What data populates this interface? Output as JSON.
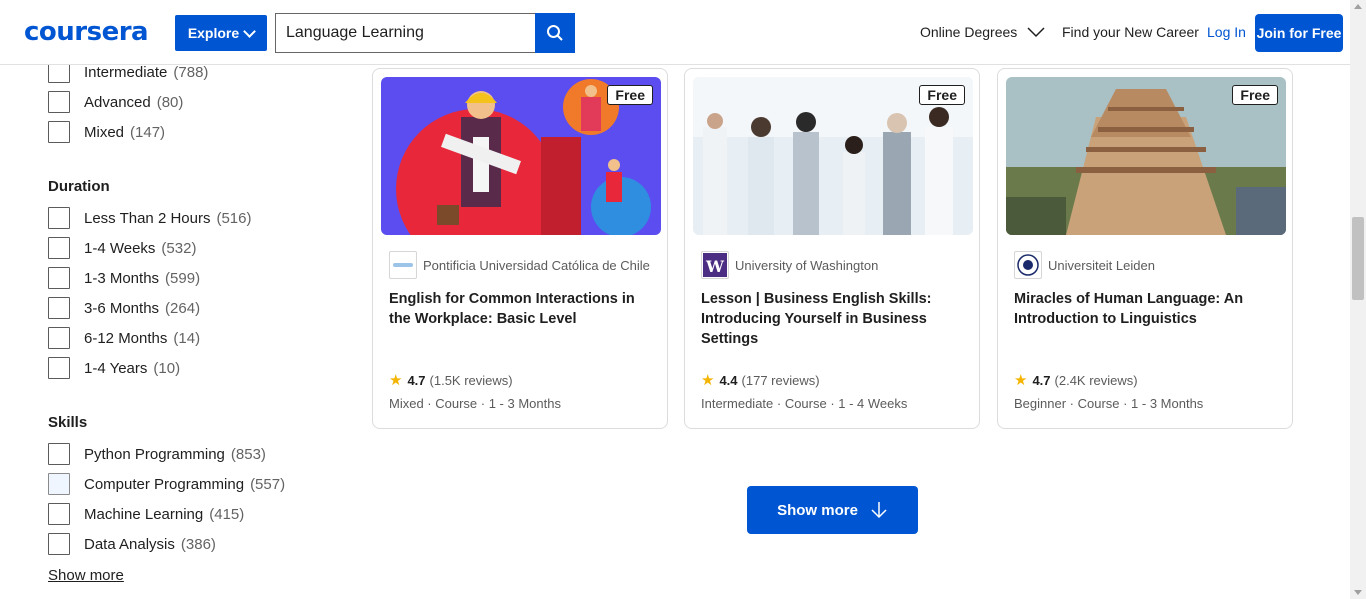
{
  "header": {
    "logo": "coursera",
    "explore_label": "Explore",
    "search_value": "Language Learning",
    "nav_degrees": "Online Degrees",
    "nav_career": "Find your New Career",
    "login": "Log In",
    "join": "Join for Free"
  },
  "filters": {
    "level_items": [
      {
        "label": "Intermediate",
        "count": "(788)"
      },
      {
        "label": "Advanced",
        "count": "(80)"
      },
      {
        "label": "Mixed",
        "count": "(147)"
      }
    ],
    "duration_heading": "Duration",
    "duration_items": [
      {
        "label": "Less Than 2 Hours",
        "count": "(516)"
      },
      {
        "label": "1-4 Weeks",
        "count": "(532)"
      },
      {
        "label": "1-3 Months",
        "count": "(599)"
      },
      {
        "label": "3-6 Months",
        "count": "(264)"
      },
      {
        "label": "6-12 Months",
        "count": "(14)"
      },
      {
        "label": "1-4 Years",
        "count": "(10)"
      }
    ],
    "skills_heading": "Skills",
    "skills_items": [
      {
        "label": "Python Programming",
        "count": "(853)"
      },
      {
        "label": "Computer Programming",
        "count": "(557)"
      },
      {
        "label": "Machine Learning",
        "count": "(415)"
      },
      {
        "label": "Data Analysis",
        "count": "(386)"
      }
    ],
    "show_more": "Show more"
  },
  "cards": [
    {
      "badge": "Free",
      "partner": "Pontificia Universidad Católica de Chile",
      "title": "English for Common Interactions in the Workplace: Basic Level",
      "rating": "4.7",
      "reviews": "(1.5K reviews)",
      "meta": "Mixed · Course · 1 - 3 Months"
    },
    {
      "badge": "Free",
      "partner": "University of Washington",
      "title": "Lesson | Business English Skills: Introducing Yourself in Business Settings",
      "rating": "4.4",
      "reviews": "(177 reviews)",
      "meta": "Intermediate · Course · 1 - 4 Weeks"
    },
    {
      "badge": "Free",
      "partner": "Universiteit Leiden",
      "title": "Miracles of Human Language: An Introduction to Linguistics",
      "rating": "4.7",
      "reviews": "(2.4K reviews)",
      "meta": "Beginner · Course · 1 - 3 Months"
    }
  ],
  "show_more_button": "Show more",
  "colors": {
    "brand": "#0056d2",
    "star": "#f4b400"
  }
}
